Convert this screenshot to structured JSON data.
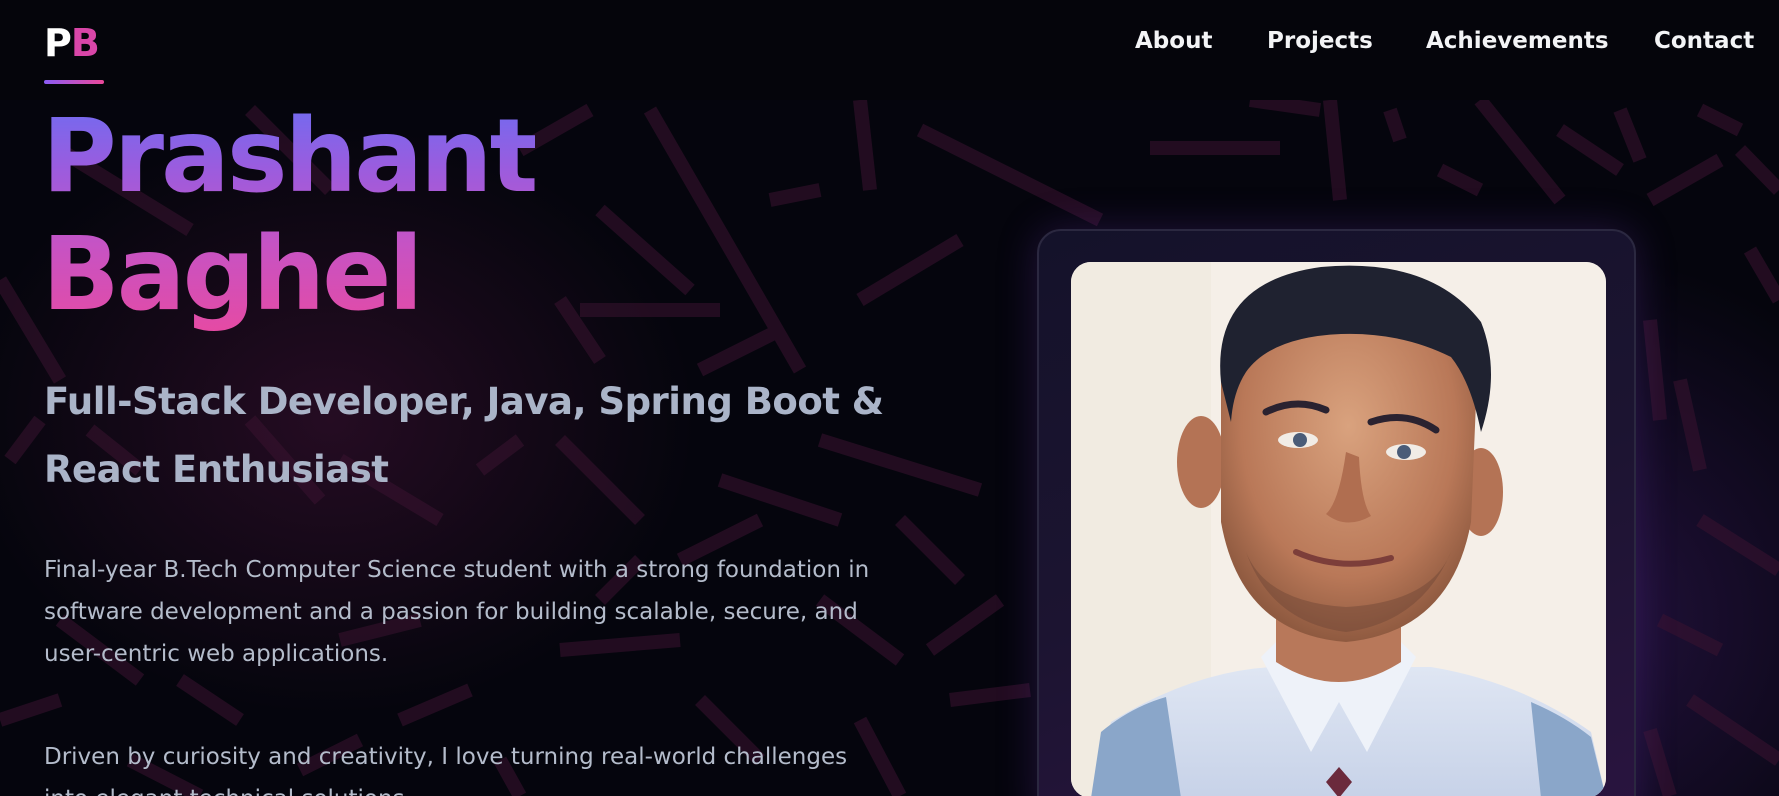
{
  "logo": {
    "letter1": "P",
    "letter2": "B"
  },
  "nav": {
    "items": [
      {
        "label": "About"
      },
      {
        "label": "Projects"
      },
      {
        "label": "Achievements"
      },
      {
        "label": "Contact"
      }
    ]
  },
  "hero": {
    "first_name": "Prashant",
    "last_name": "Baghel",
    "tagline": "Full-Stack Developer, Java, Spring Boot & React Enthusiast",
    "paragraph1": "Final-year B.Tech Computer Science student with a strong foundation in software development and a passion for building scalable, secure, and user-centric web applications.",
    "paragraph2": "Driven by curiosity and creativity, I love turning real-world challenges into elegant technical solutions."
  },
  "colors": {
    "background": "#05050d",
    "accent_start": "#6d6cf2",
    "accent_end": "#e64aa3",
    "text_muted": "#b4bccb"
  }
}
